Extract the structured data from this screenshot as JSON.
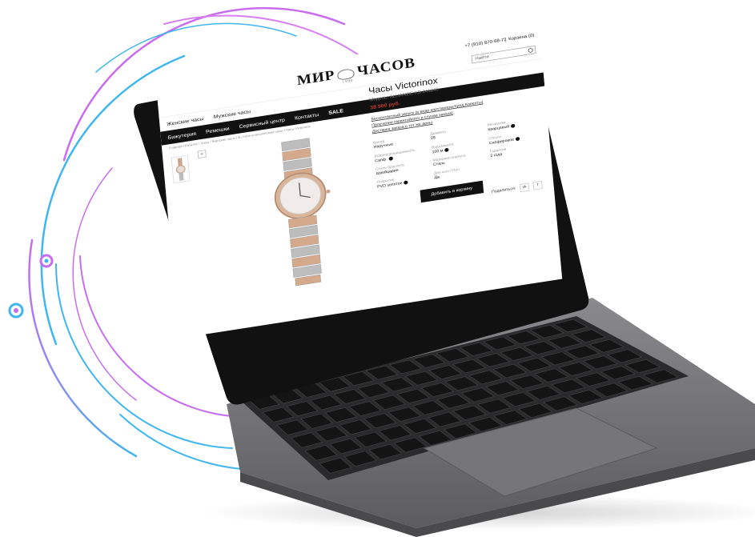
{
  "header": {
    "logo_left": "МИР",
    "logo_right": "ЧАСОВ",
    "logo_sub": "1990",
    "phone": "+7 (910) 870-68-72",
    "cart": "Корзина (0)",
    "search_placeholder": "Найти"
  },
  "gender_nav": [
    "Женские часы",
    "Мужские часы"
  ],
  "main_nav": [
    "Бижутерия",
    "Ремешки",
    "Сервисный центр",
    "Контакты",
    "SALE"
  ],
  "breadcrumbs": "Главная / Каталог / Часы / Женские часы / В стиле классическом часы / Часы Victorinox",
  "product": {
    "title": "Часы Victorinox",
    "model": "Модель: ALLIANCE XS 241840",
    "price": "38 900 руб.",
    "links": [
      "Бесконтактный запуск (в виде карт/заказы/пред.Клиенты)",
      "Получение гарантийного в случае заказа)",
      "Доставка заказа в тот же день)"
    ],
    "specs": [
      {
        "label": "Бренд",
        "value": "Наручные"
      },
      {
        "label": "Диаметр",
        "value": "28"
      },
      {
        "label": "Механизм",
        "value": "Кварцевый"
      },
      {
        "label": "Водонепроницаемость",
        "value": "Сапф."
      },
      {
        "label": "Водозащита",
        "value": "100 м"
      },
      {
        "label": "Стекло",
        "value": "Сапфировое"
      },
      {
        "label": "Стиль браслета",
        "value": "Швейцария"
      },
      {
        "label": "Материал корпуса",
        "value": "Сталь"
      },
      {
        "label": "Гарантия",
        "value": "2 года"
      },
      {
        "label": "Покрытие",
        "value": "PVD золотое"
      },
      {
        "label": "Для кого / Пол",
        "value": "Да"
      },
      {
        "label": "",
        "value": ""
      }
    ],
    "add_to_cart": "Добавить в корзину",
    "share_label": "Поделиться:",
    "social": [
      "vk",
      "f"
    ]
  },
  "colors": {
    "arc_pink": "#c86df0",
    "arc_blue": "#3fb6f0",
    "laptop_body": "#6f6f72",
    "bezel": "#111111",
    "price": "#c0392b"
  }
}
